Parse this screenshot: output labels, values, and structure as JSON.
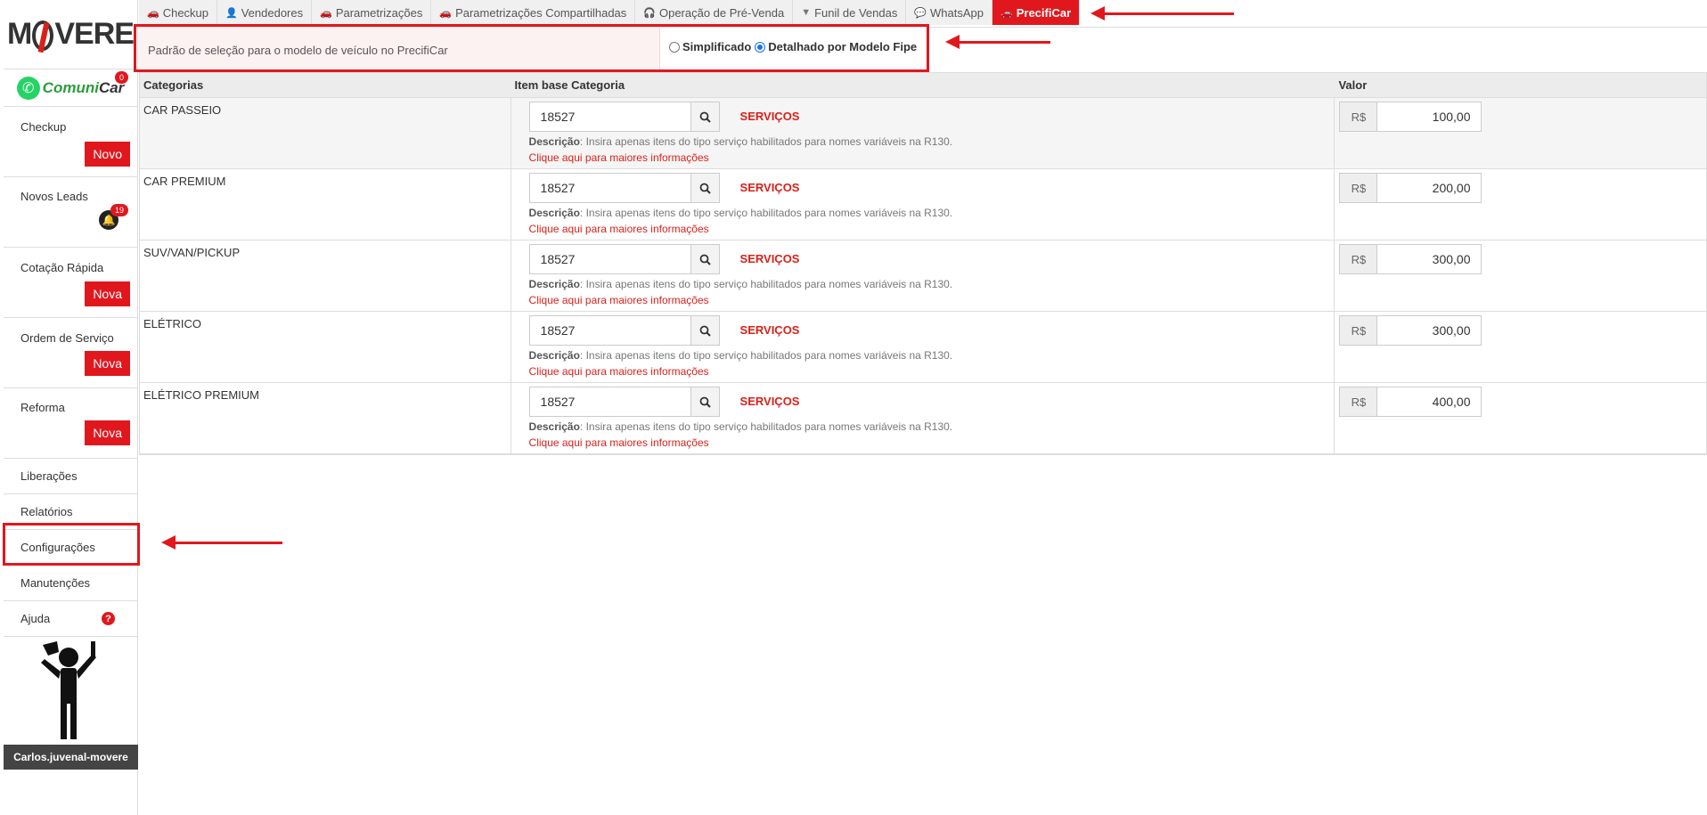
{
  "brand": {
    "logo_pre": "M",
    "logo_post": "VERE",
    "comunicar_a": "Comuni",
    "comunicar_b": "Car",
    "comunicar_badge": "0"
  },
  "sidebar": {
    "checkup": {
      "label": "Checkup",
      "button": "Novo"
    },
    "leads": {
      "label": "Novos Leads",
      "badge": "19"
    },
    "cotacao": {
      "label": "Cotação Rápida",
      "button": "Nova"
    },
    "ordem": {
      "label": "Ordem de Serviço",
      "button": "Nova"
    },
    "reforma": {
      "label": "Reforma",
      "button": "Nova"
    },
    "links": [
      "Liberações",
      "Relatórios",
      "Configurações",
      "Manutenções",
      "Ajuda"
    ],
    "username": "Carlos.juvenal-movere"
  },
  "tabs": [
    {
      "label": "Checkup",
      "icon": "car-icon"
    },
    {
      "label": "Vendedores",
      "icon": "user-icon"
    },
    {
      "label": "Parametrizações",
      "icon": "car-icon"
    },
    {
      "label": "Parametrizações Compartilhadas",
      "icon": "car-icon"
    },
    {
      "label": "Operação de Pré-Venda",
      "icon": "headset-icon"
    },
    {
      "label": "Funil de Vendas",
      "icon": "filter-icon"
    },
    {
      "label": "WhatsApp",
      "icon": "chat-icon"
    },
    {
      "label": "PrecifiCar",
      "icon": "car-icon"
    }
  ],
  "setting": {
    "label": "Padrão de seleção para o modelo de veículo no PrecifiCar",
    "option_simple": "Simplificado",
    "option_detailed": "Detalhado por Modelo Fipe",
    "selected": "Detalhado por Modelo Fipe"
  },
  "table": {
    "headers": {
      "category": "Categorias",
      "item": "Item base Categoria",
      "value": "Valor"
    },
    "desc_label": "Descrição",
    "desc_text": ": Insira apenas itens do tipo serviço habilitados para nomes variáveis na R130.",
    "more_link": "Clique aqui para maiores informações",
    "currency": "R$",
    "rows": [
      {
        "category": "CAR PASSEIO",
        "item": "18527",
        "type": "SERVIÇOS",
        "value": "100,00"
      },
      {
        "category": "CAR PREMIUM",
        "item": "18527",
        "type": "SERVIÇOS",
        "value": "200,00"
      },
      {
        "category": "SUV/VAN/PICKUP",
        "item": "18527",
        "type": "SERVIÇOS",
        "value": "300,00"
      },
      {
        "category": "ELÉTRICO",
        "item": "18527",
        "type": "SERVIÇOS",
        "value": "300,00"
      },
      {
        "category": "ELÉTRICO PREMIUM",
        "item": "18527",
        "type": "SERVIÇOS",
        "value": "400,00"
      }
    ]
  },
  "colors": {
    "accent": "#e0181e",
    "whatsapp": "#25d366"
  }
}
